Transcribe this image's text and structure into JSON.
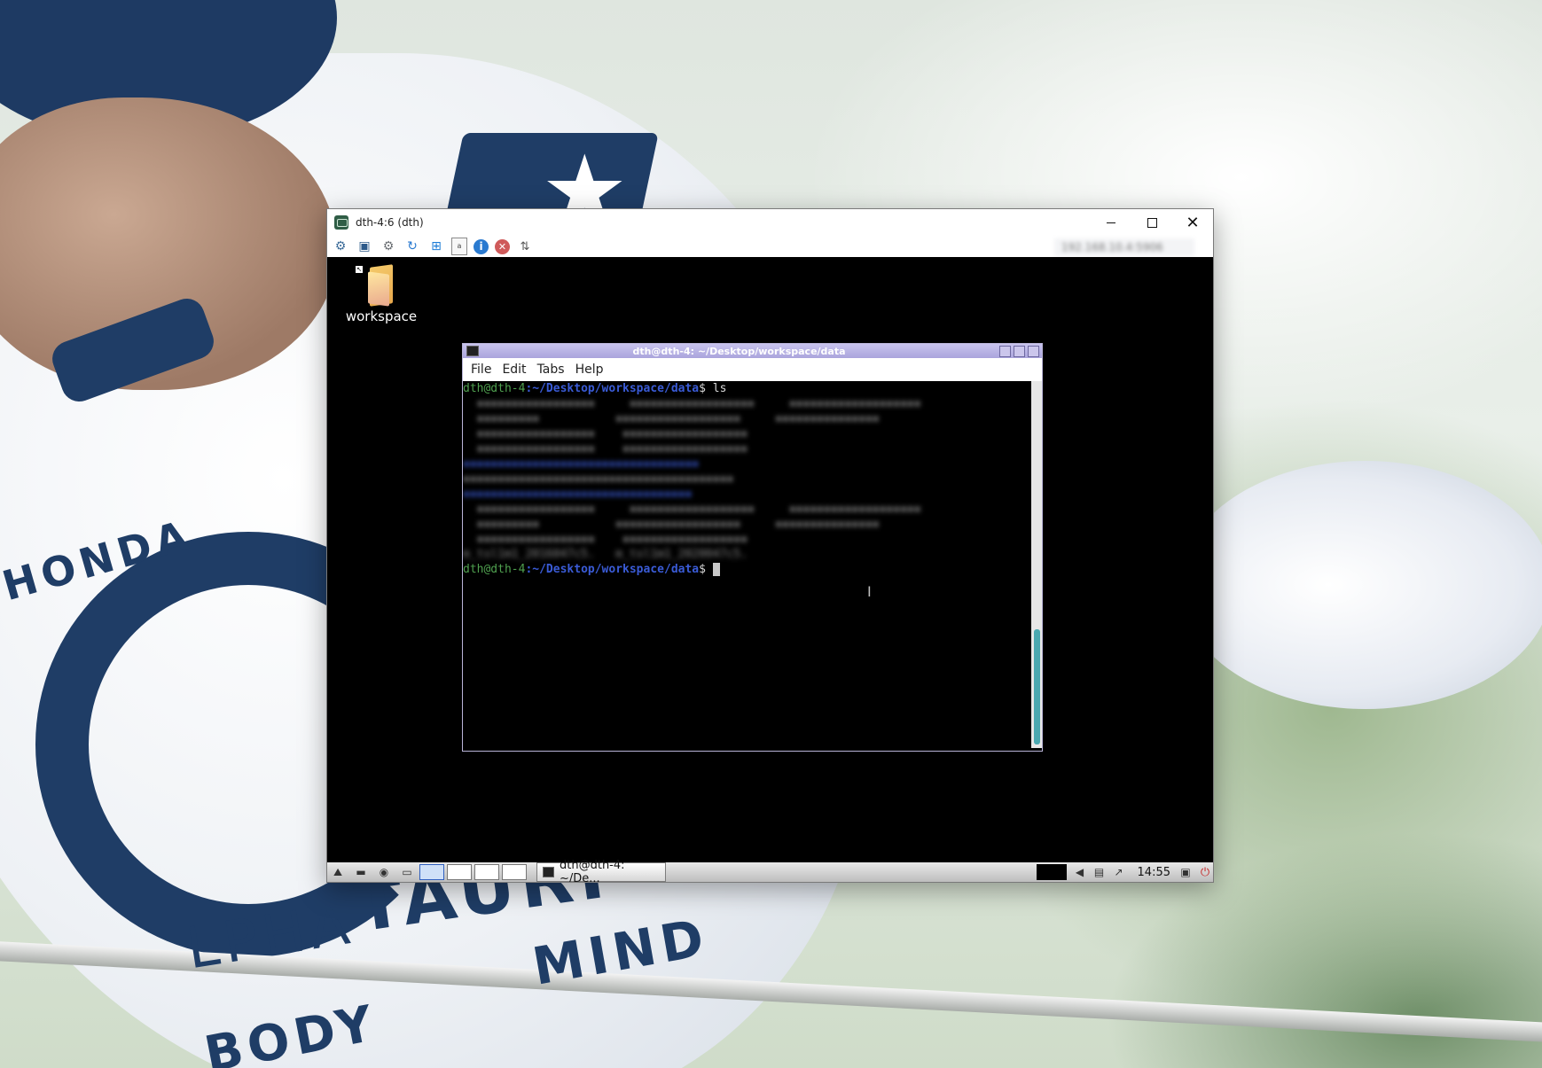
{
  "vnc_window": {
    "title": "dth-4:6 (dth)",
    "address": "192.168.10.4:5906"
  },
  "icons": {
    "vnc_app": "vnc-viewer-icon",
    "toolbar": [
      "options-icon",
      "fullscreen-icon",
      "settings-icon",
      "refresh-icon",
      "windows-key-icon",
      "clipboard-icon",
      "info-icon",
      "disconnect-icon",
      "file-transfer-icon"
    ]
  },
  "desktop": {
    "icon_label": "workspace"
  },
  "terminal": {
    "title": "dth@dth-4: ~/Desktop/workspace/data",
    "menu": {
      "file": "File",
      "edit": "Edit",
      "tabs": "Tabs",
      "help": "Help"
    },
    "prompt_user": "dth@dth-4",
    "prompt_path": ":~/Desktop/workspace/data",
    "prompt_symbol": "$ ",
    "first_command": "ls",
    "tail_output": "m_tsl1m1_2016047c5.   m_tsl1m1_2020047c5."
  },
  "taskbar": {
    "task_label": "dth@dth-4: ~/De...",
    "clock": "14:55"
  },
  "wallpaper": {
    "honda": "HONDA",
    "alpha": "LPHA",
    "tauri": "TAURI",
    "mind": "MIND",
    "body": "BODY",
    "nd": "N D"
  },
  "colors": {
    "terminal_title_bg": "#aaa4dc",
    "prompt_user": "#4fa04f",
    "prompt_path": "#3a5bd6",
    "scroll_thumb": "#4aa8b0"
  }
}
